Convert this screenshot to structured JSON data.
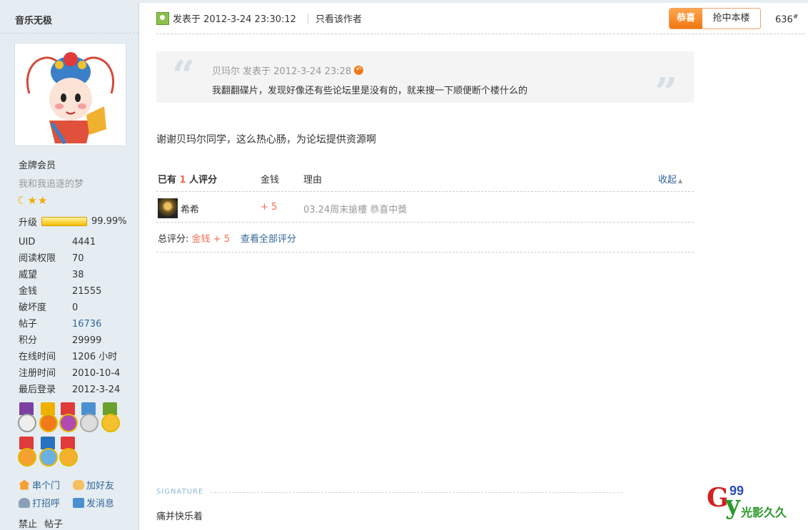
{
  "author": {
    "username": "音乐无极",
    "rank": "金牌会员",
    "custom_status": "我和我追逐的梦",
    "star_icons": [
      "moon-icon",
      "star-icon",
      "star-icon"
    ],
    "upgrade_label": "升级",
    "upgrade_progress": 0.9999,
    "upgrade_percent": "99.99%",
    "stats": [
      {
        "label": "UID",
        "value": "4441"
      },
      {
        "label": "阅读权限",
        "value": "70"
      },
      {
        "label": "威望",
        "value": "38"
      },
      {
        "label": "金钱",
        "value": "21555"
      },
      {
        "label": "破坏度",
        "value": "0"
      },
      {
        "label": "帖子",
        "value": "16736"
      },
      {
        "label": "积分",
        "value": "29999"
      },
      {
        "label": "在线时间",
        "value": "1206 小时"
      },
      {
        "label": "注册时间",
        "value": "2010-10-4"
      },
      {
        "label": "最后登录",
        "value": "2012-3-24"
      }
    ],
    "actions": {
      "visit": "串个门",
      "add_friend": "加好友",
      "greet": "打招呼",
      "message": "发消息"
    },
    "ban_links": [
      "禁止",
      "帖子"
    ]
  },
  "post": {
    "posted_at": "发表于 2012-3-24 23:30:12",
    "only_author": "只看该作者",
    "congrats_label": "恭喜",
    "grab_floor_label": "抢中本楼",
    "floor_number": "636",
    "floor_symbol": "#",
    "quote": {
      "author_line": "贝玛尔 发表于 2012-3-24 23:28",
      "text": "我翻翻碟片，发现好像还有些论坛里是没有的，就来搜一下顺便断个楼什么的"
    },
    "body": "谢谢贝玛尔同学，这么热心肠，为论坛提供资源啊"
  },
  "rating": {
    "header_prefix": "已有",
    "header_count": "1",
    "header_suffix": "人评分",
    "col_money": "金钱",
    "col_reason": "理由",
    "collapse": "收起",
    "rows": [
      {
        "user": "希希",
        "amount": "+ 5",
        "reason": "03.24周末搶樓 恭喜中獎"
      }
    ],
    "total_label": "总评分:",
    "total_value": "金钱 + 5",
    "view_all": "查看全部评分"
  },
  "signature": {
    "label": "SIGNATURE",
    "text": "痛并快乐着"
  },
  "watermark": {
    "logo_letters": "Gy",
    "logo_number": "99",
    "logo_text": "光影久久"
  },
  "colors": {
    "sidebar_bg": "#e5edf2",
    "link": "#336699",
    "accent_orange": "#f26c4f",
    "button_orange": "#f0770f"
  }
}
